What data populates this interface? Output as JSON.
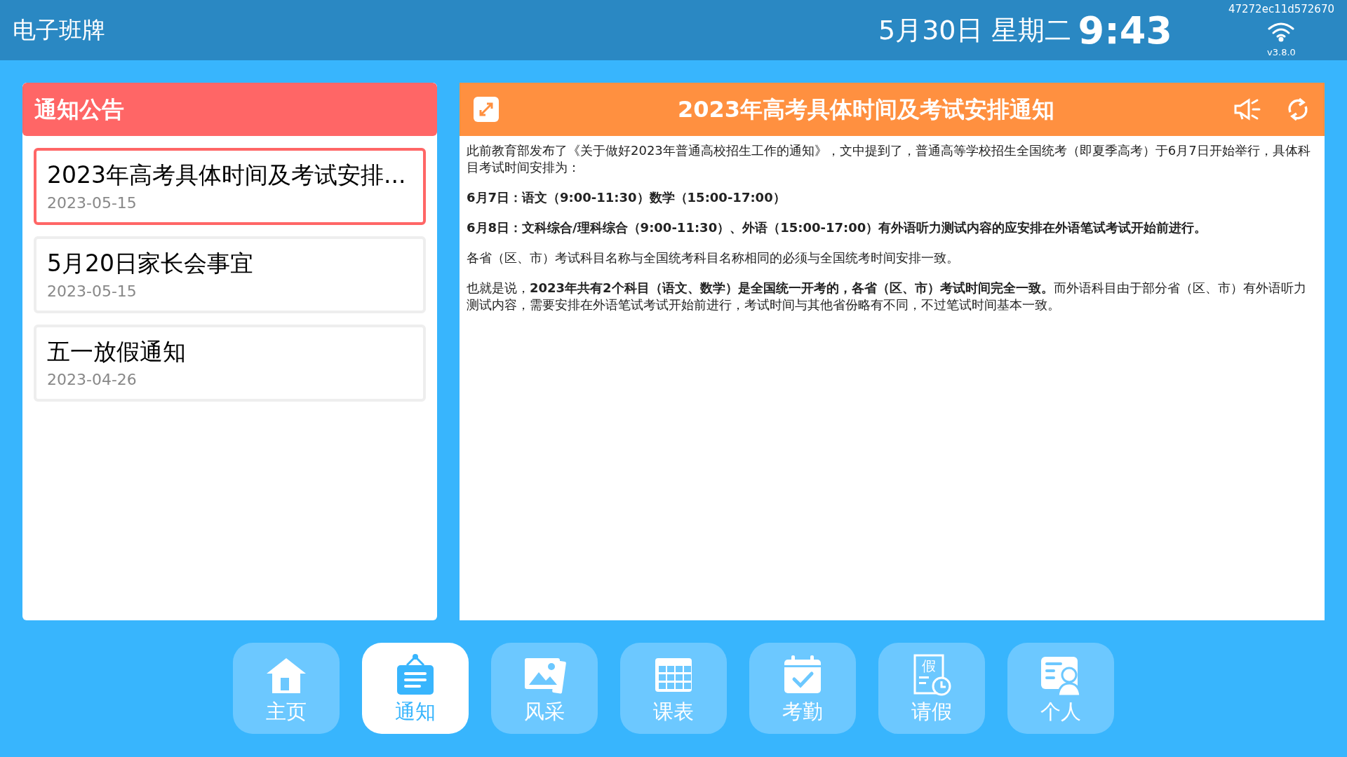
{
  "top_bar": {
    "title": "电子班牌",
    "date": "5月30日 星期二",
    "time": "9:43",
    "device_id": "47272ec11d572670",
    "version": "v3.8.0"
  },
  "notice_list": {
    "title": "通知公告",
    "items": [
      {
        "title": "2023年高考具体时间及考试安排...",
        "date": "2023-05-15",
        "selected": true
      },
      {
        "title": "5月20日家长会事宜",
        "date": "2023-05-15",
        "selected": false
      },
      {
        "title": "五一放假通知",
        "date": "2023-04-26",
        "selected": false
      }
    ]
  },
  "notice_detail": {
    "title": "2023年高考具体时间及考试安排通知",
    "paragraphs": [
      {
        "text": "此前教育部发布了《关于做好2023年普通高校招生工作的通知》，文中提到了，普通高等学校招生全国统考（即夏季高考）于6月7日开始举行，具体科目考试时间安排为：",
        "bold": false
      },
      {
        "text": "6月7日：语文（9:00-11:30）数学（15:00-17:00）",
        "bold": true
      },
      {
        "text": "6月8日：文科综合/理科综合（9:00-11:30）、外语（15:00-17:00）有外语听力测试内容的应安排在外语笔试考试开始前进行。",
        "bold": true
      },
      {
        "text": "各省（区、市）考试科目名称与全国统考科目名称相同的必须与全国统考时间安排一致。",
        "bold": false
      },
      {
        "text": "也就是说，**2023年共有2个科目（语文、数学）是全国统一开考的，各省（区、市）考试时间完全一致。**而外语科目由于部分省（区、市）有外语听力测试内容，需要安排在外语笔试考试开始前进行，考试时间与其他省份略有不同，不过笔试时间基本一致。",
        "bold": false
      }
    ]
  },
  "bottom_nav": [
    {
      "kind": "home",
      "label": "主页",
      "selected": false
    },
    {
      "kind": "notice",
      "label": "通知",
      "selected": true
    },
    {
      "kind": "gallery",
      "label": "风采",
      "selected": false
    },
    {
      "kind": "timetable",
      "label": "课表",
      "selected": false
    },
    {
      "kind": "attendance",
      "label": "考勤",
      "selected": false
    },
    {
      "kind": "leave",
      "label": "请假",
      "icon_glyph": "假",
      "selected": false
    },
    {
      "kind": "profile",
      "label": "个人",
      "selected": false
    }
  ]
}
